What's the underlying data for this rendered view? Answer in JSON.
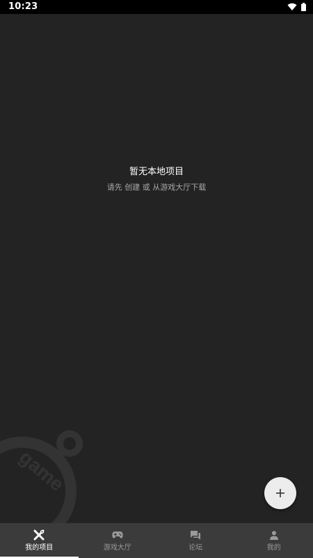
{
  "status_bar": {
    "time": "10:23",
    "wifi_icon": "wifi-icon",
    "battery_icon": "battery-icon"
  },
  "empty_state": {
    "title": "暂无本地项目",
    "subtitle": "请先 创建 或 从游戏大厅下载"
  },
  "watermark": {
    "text": "game"
  },
  "fab": {
    "icon": "plus-icon",
    "label": "+"
  },
  "bottom_nav": {
    "items": [
      {
        "label": "我的项目",
        "icon": "tools-icon",
        "active": true
      },
      {
        "label": "游戏大厅",
        "icon": "gamepad-icon",
        "active": false
      },
      {
        "label": "论坛",
        "icon": "forum-icon",
        "active": false
      },
      {
        "label": "我的",
        "icon": "person-icon",
        "active": false
      }
    ]
  },
  "colors": {
    "background": "#232323",
    "status_bar": "#000000",
    "nav_bar": "#3b3b3b",
    "fab": "#ececec",
    "active_text": "#ffffff",
    "inactive_text": "#9a9a9a"
  }
}
